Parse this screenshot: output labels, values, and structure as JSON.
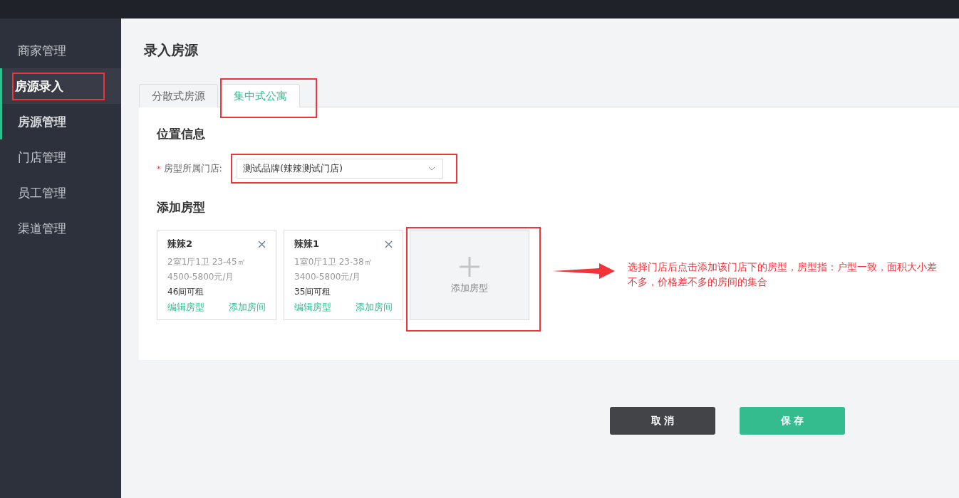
{
  "sidebar": {
    "items": [
      {
        "label": "商家管理",
        "selected": false,
        "accent": false,
        "highlighted": false
      },
      {
        "label": "房源录入",
        "selected": true,
        "accent": true,
        "highlighted": true
      },
      {
        "label": "房源管理",
        "selected": false,
        "accent": true,
        "highlighted": false
      },
      {
        "label": "门店管理",
        "selected": false,
        "accent": false,
        "highlighted": false
      },
      {
        "label": "员工管理",
        "selected": false,
        "accent": false,
        "highlighted": false
      },
      {
        "label": "渠道管理",
        "selected": false,
        "accent": false,
        "highlighted": false
      }
    ]
  },
  "page_title": "录入房源",
  "tabs": [
    {
      "label": "分散式房源",
      "selected": false,
      "highlighted": false
    },
    {
      "label": "集中式公寓",
      "selected": true,
      "highlighted": true
    }
  ],
  "location": {
    "heading": "位置信息",
    "required_mark": "*",
    "label": "房型所属门店:",
    "value": "测试品牌(辣辣测试门店)",
    "highlighted": true
  },
  "room_types": {
    "heading": "添加房型",
    "cards": [
      {
        "name": "辣辣2",
        "layout": "2室1厅1卫 23-45㎡",
        "price": "4500-5800元/月",
        "available": "46间可租",
        "edit": "编辑房型",
        "add_room": "添加房间"
      },
      {
        "name": "辣辣1",
        "layout": "1室0厅1卫 23-38㎡",
        "price": "3400-5800元/月",
        "available": "35间可租",
        "edit": "编辑房型",
        "add_room": "添加房间"
      }
    ],
    "add_card": {
      "label": "添加房型",
      "highlighted": true
    }
  },
  "annotation": "选择门店后点击添加该门店下的房型，房型指：户型一致，面积大小差不多，价格差不多的房间的集合",
  "buttons": [
    {
      "kind": "cancel",
      "label": "取 消"
    },
    {
      "kind": "save",
      "label": "保 存"
    }
  ]
}
